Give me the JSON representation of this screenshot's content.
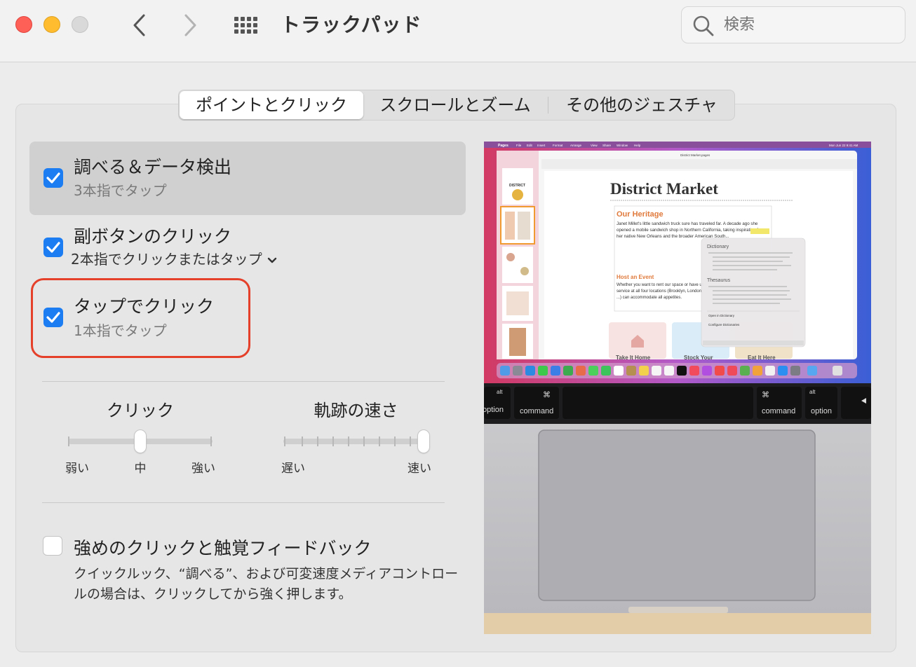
{
  "window": {
    "title": "トラックパッド",
    "search_placeholder": "検索"
  },
  "tabs": [
    {
      "label": "ポイントとクリック",
      "selected": true
    },
    {
      "label": "スクロールとズーム",
      "selected": false
    },
    {
      "label": "その他のジェスチャ",
      "selected": false
    }
  ],
  "options": {
    "lookup": {
      "title": "調べる＆データ検出",
      "subtitle": "3本指でタップ",
      "checked": true
    },
    "secondary_click": {
      "title": "副ボタンのクリック",
      "subtitle": "2本指でクリックまたはタップ",
      "checked": true
    },
    "tap_to_click": {
      "title": "タップでクリック",
      "subtitle": "1本指でタップ",
      "checked": true
    },
    "force_click": {
      "title": "強めのクリックと触覚フィードバック",
      "description": "クイックルック、“調べる”、および可変速度メディアコントロールの場合は、クリックしてから強く押します。",
      "checked": false
    }
  },
  "sliders": {
    "click": {
      "title": "クリック",
      "min_label": "弱い",
      "mid_label": "中",
      "max_label": "強い",
      "value_fraction": 0.5
    },
    "tracking": {
      "title": "軌跡の速さ",
      "min_label": "遅い",
      "max_label": "速い",
      "value_fraction": 1.0
    }
  },
  "preview": {
    "menubar_app": "Pages",
    "menubar_items": [
      "File",
      "Edit",
      "Insert",
      "Format",
      "Arrange",
      "View",
      "Share",
      "Window",
      "Help"
    ],
    "menubar_clock": "Mon Jun 22  9:41 AM",
    "document_title": "District Market.pages",
    "doc_heading": "District Market",
    "section_heading": "Our Heritage",
    "body_text": "Janet Millet's little sandwich truck sure has traveled far. A decade ago she opened a mobile sandwich shop in Northern California, taking inspiration from her native New Orleans and the broader American South...",
    "event_heading": "Host an Event",
    "event_text": "Whether you want to rent our space or have us service at all four locations (Brooklyn, London, ...) can accommodate all appetites.",
    "highlight_word": "inspiration",
    "popover_dictionary": "Dictionary",
    "popover_thesaurus": "Thesaurus",
    "popover_open": "Open in Dictionary",
    "popover_configure": "Configure Dictionaries",
    "cards": [
      "Take It Home",
      "Stock Your",
      "Eat It Here"
    ],
    "thumb_label": "DISTRICT",
    "keys": {
      "left_alt": "alt",
      "left_option": "option",
      "left_command": "command",
      "command_symbol": "⌘",
      "right_command": "command",
      "right_alt": "alt",
      "right_option": "option"
    }
  },
  "colors": {
    "accent": "#1c7cf2",
    "highlight_ring": "#e4402a"
  }
}
